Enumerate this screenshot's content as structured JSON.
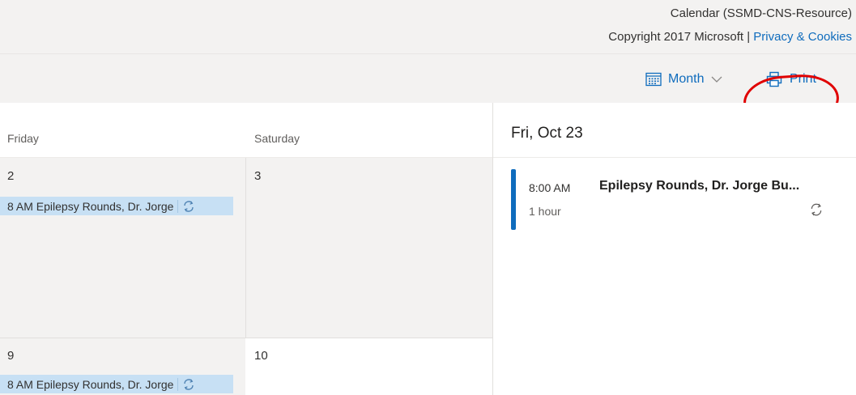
{
  "header": {
    "calendar_name": "Calendar (SSMD-CNS-Resource)",
    "copyright_text": "Copyright 2017 Microsoft | ",
    "privacy_link": "Privacy & Cookies"
  },
  "toolbar": {
    "view_label": "Month",
    "print_label": "Print"
  },
  "month_grid": {
    "day_headers": [
      "Friday",
      "Saturday"
    ],
    "weeks": [
      {
        "friday_date": "2",
        "saturday_date": "3",
        "friday_event": "8 AM Epilepsy Rounds, Dr. Jorge"
      },
      {
        "friday_date": "9",
        "saturday_date": "10",
        "friday_event": "8 AM Epilepsy Rounds, Dr. Jorge"
      }
    ]
  },
  "agenda": {
    "date_title": "Fri, Oct 23",
    "event": {
      "time": "8:00 AM",
      "duration": "1 hour",
      "title": "Epilepsy Rounds, Dr. Jorge Bu..."
    }
  },
  "colors": {
    "accent": "#0f6cbd",
    "event_fill": "#c7e0f4",
    "annotation": "#e00000"
  },
  "icons": [
    "calendar-grid-icon",
    "chevron-down-icon",
    "printer-icon",
    "recurring-icon"
  ]
}
